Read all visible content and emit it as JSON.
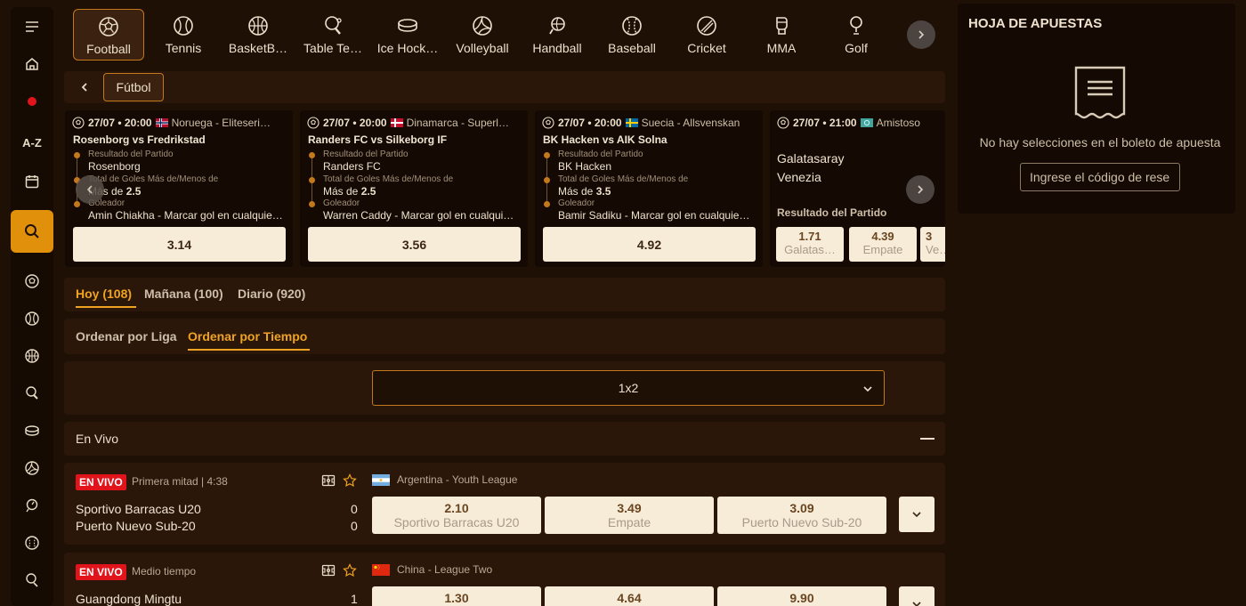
{
  "sports": [
    {
      "label": "Football",
      "icon": "soccer-ball-icon",
      "active": true
    },
    {
      "label": "Tennis",
      "icon": "tennis-ball-icon"
    },
    {
      "label": "BasketB…",
      "icon": "basketball-icon"
    },
    {
      "label": "Table Te…",
      "icon": "table-tennis-icon"
    },
    {
      "label": "Ice Hock…",
      "icon": "ice-hockey-puck-icon"
    },
    {
      "label": "Volleyball",
      "icon": "volleyball-icon"
    },
    {
      "label": "Handball",
      "icon": "handball-icon"
    },
    {
      "label": "Baseball",
      "icon": "baseball-icon"
    },
    {
      "label": "Cricket",
      "icon": "cricket-icon"
    },
    {
      "label": "MMA",
      "icon": "mma-glove-icon"
    },
    {
      "label": "Golf",
      "icon": "golf-icon"
    }
  ],
  "rail": {
    "az_label": "A-Z"
  },
  "breadcrumb": {
    "label": "Fútbol"
  },
  "featured": [
    {
      "time": "27/07 • 20:00",
      "league": "Noruega - Eliteseri…",
      "match": "Rosenborg vs Fredrikstad",
      "markets": [
        {
          "market": "Resultado del Partido",
          "selection": "Rosenborg"
        },
        {
          "market": "Total de Goles Más de/Menos de",
          "selection_prefix": "Más de ",
          "selection_bold": "2.5"
        },
        {
          "market": "Goleador",
          "selection": "Amin Chiakha - Marcar gol en cualquie…"
        }
      ],
      "odds": "3.14"
    },
    {
      "time": "27/07 • 20:00",
      "league": "Dinamarca - Superl…",
      "match": "Randers FC vs Silkeborg IF",
      "markets": [
        {
          "market": "Resultado del Partido",
          "selection": "Randers FC"
        },
        {
          "market": "Total de Goles Más de/Menos de",
          "selection_prefix": "Más de ",
          "selection_bold": "2.5"
        },
        {
          "market": "Goleador",
          "selection": "Warren Caddy - Marcar gol en cualqui…"
        }
      ],
      "odds": "3.56"
    },
    {
      "time": "27/07 • 20:00",
      "league": "Suecia - Allsvenskan",
      "match": "BK Hacken vs AIK Solna",
      "markets": [
        {
          "market": "Resultado del Partido",
          "selection": "BK Hacken"
        },
        {
          "market": "Total de Goles Más de/Menos de",
          "selection_prefix": "Más de ",
          "selection_bold": "3.5"
        },
        {
          "market": "Goleador",
          "selection": "Bamir Sadiku - Marcar gol en cualquie…"
        }
      ],
      "odds": "4.92"
    },
    {
      "time": "27/07 • 21:00",
      "league": "Amistoso",
      "home": "Galatasaray",
      "away": "Venezia",
      "market": "Resultado del Partido",
      "odds": [
        {
          "value": "1.71",
          "label": "Galatas…"
        },
        {
          "value": "4.39",
          "label": "Empate"
        },
        {
          "value": "3",
          "label": "Ve…"
        }
      ]
    }
  ],
  "day_tabs": [
    {
      "label": "Hoy (108)",
      "active": true
    },
    {
      "label": "Mañana (100)"
    },
    {
      "label": "Diario (920)"
    }
  ],
  "sort_tabs": [
    {
      "label": "Ordenar por Liga"
    },
    {
      "label": "Ordenar por Tiempo",
      "active": true
    }
  ],
  "market_select": {
    "value": "1x2"
  },
  "live_section": {
    "title": "En Vivo"
  },
  "events": [
    {
      "badge": "EN VIVO",
      "status": "Primera mitad | 4:38",
      "league": "Argentina - Youth League",
      "home": "Sportivo Barracas U20",
      "away": "Puerto Nuevo Sub-20",
      "home_score": "0",
      "away_score": "0",
      "odds": [
        {
          "value": "2.10",
          "label": "Sportivo Barracas U20"
        },
        {
          "value": "3.49",
          "label": "Empate"
        },
        {
          "value": "3.09",
          "label": "Puerto Nuevo Sub-20"
        }
      ]
    },
    {
      "badge": "EN VIVO",
      "status": "Medio tiempo",
      "league": "China - League Two",
      "home": "Guangdong Mingtu",
      "away": "",
      "home_score": "1",
      "away_score": "",
      "odds": [
        {
          "value": "1.30",
          "label": ""
        },
        {
          "value": "4.64",
          "label": ""
        },
        {
          "value": "9.90",
          "label": ""
        }
      ]
    }
  ],
  "betslip": {
    "title": "HOJA DE APUESTAS",
    "empty": "No hay selecciones en el boleto de apuesta",
    "code_placeholder": "Ingrese el código de reserva"
  },
  "colors": {
    "accent": "#f0a320",
    "live_red": "#e0141a",
    "odds_bg": "#f7ecd8",
    "panel": "#2a1709",
    "background": "#1f1006"
  }
}
